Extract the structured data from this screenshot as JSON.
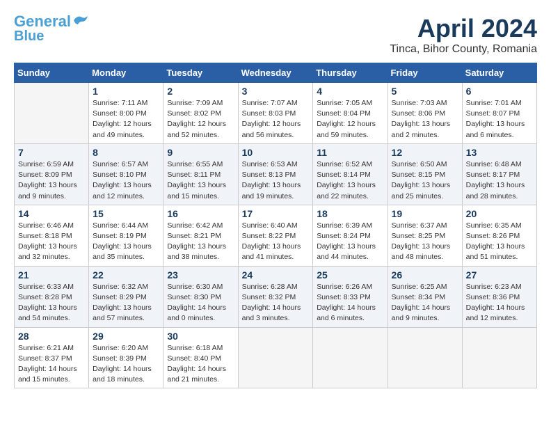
{
  "header": {
    "logo_line1": "General",
    "logo_line2": "Blue",
    "month_year": "April 2024",
    "location": "Tinca, Bihor County, Romania"
  },
  "weekdays": [
    "Sunday",
    "Monday",
    "Tuesday",
    "Wednesday",
    "Thursday",
    "Friday",
    "Saturday"
  ],
  "weeks": [
    [
      {
        "day": "",
        "info": ""
      },
      {
        "day": "1",
        "info": "Sunrise: 7:11 AM\nSunset: 8:00 PM\nDaylight: 12 hours\nand 49 minutes."
      },
      {
        "day": "2",
        "info": "Sunrise: 7:09 AM\nSunset: 8:02 PM\nDaylight: 12 hours\nand 52 minutes."
      },
      {
        "day": "3",
        "info": "Sunrise: 7:07 AM\nSunset: 8:03 PM\nDaylight: 12 hours\nand 56 minutes."
      },
      {
        "day": "4",
        "info": "Sunrise: 7:05 AM\nSunset: 8:04 PM\nDaylight: 12 hours\nand 59 minutes."
      },
      {
        "day": "5",
        "info": "Sunrise: 7:03 AM\nSunset: 8:06 PM\nDaylight: 13 hours\nand 2 minutes."
      },
      {
        "day": "6",
        "info": "Sunrise: 7:01 AM\nSunset: 8:07 PM\nDaylight: 13 hours\nand 6 minutes."
      }
    ],
    [
      {
        "day": "7",
        "info": "Sunrise: 6:59 AM\nSunset: 8:09 PM\nDaylight: 13 hours\nand 9 minutes."
      },
      {
        "day": "8",
        "info": "Sunrise: 6:57 AM\nSunset: 8:10 PM\nDaylight: 13 hours\nand 12 minutes."
      },
      {
        "day": "9",
        "info": "Sunrise: 6:55 AM\nSunset: 8:11 PM\nDaylight: 13 hours\nand 15 minutes."
      },
      {
        "day": "10",
        "info": "Sunrise: 6:53 AM\nSunset: 8:13 PM\nDaylight: 13 hours\nand 19 minutes."
      },
      {
        "day": "11",
        "info": "Sunrise: 6:52 AM\nSunset: 8:14 PM\nDaylight: 13 hours\nand 22 minutes."
      },
      {
        "day": "12",
        "info": "Sunrise: 6:50 AM\nSunset: 8:15 PM\nDaylight: 13 hours\nand 25 minutes."
      },
      {
        "day": "13",
        "info": "Sunrise: 6:48 AM\nSunset: 8:17 PM\nDaylight: 13 hours\nand 28 minutes."
      }
    ],
    [
      {
        "day": "14",
        "info": "Sunrise: 6:46 AM\nSunset: 8:18 PM\nDaylight: 13 hours\nand 32 minutes."
      },
      {
        "day": "15",
        "info": "Sunrise: 6:44 AM\nSunset: 8:19 PM\nDaylight: 13 hours\nand 35 minutes."
      },
      {
        "day": "16",
        "info": "Sunrise: 6:42 AM\nSunset: 8:21 PM\nDaylight: 13 hours\nand 38 minutes."
      },
      {
        "day": "17",
        "info": "Sunrise: 6:40 AM\nSunset: 8:22 PM\nDaylight: 13 hours\nand 41 minutes."
      },
      {
        "day": "18",
        "info": "Sunrise: 6:39 AM\nSunset: 8:24 PM\nDaylight: 13 hours\nand 44 minutes."
      },
      {
        "day": "19",
        "info": "Sunrise: 6:37 AM\nSunset: 8:25 PM\nDaylight: 13 hours\nand 48 minutes."
      },
      {
        "day": "20",
        "info": "Sunrise: 6:35 AM\nSunset: 8:26 PM\nDaylight: 13 hours\nand 51 minutes."
      }
    ],
    [
      {
        "day": "21",
        "info": "Sunrise: 6:33 AM\nSunset: 8:28 PM\nDaylight: 13 hours\nand 54 minutes."
      },
      {
        "day": "22",
        "info": "Sunrise: 6:32 AM\nSunset: 8:29 PM\nDaylight: 13 hours\nand 57 minutes."
      },
      {
        "day": "23",
        "info": "Sunrise: 6:30 AM\nSunset: 8:30 PM\nDaylight: 14 hours\nand 0 minutes."
      },
      {
        "day": "24",
        "info": "Sunrise: 6:28 AM\nSunset: 8:32 PM\nDaylight: 14 hours\nand 3 minutes."
      },
      {
        "day": "25",
        "info": "Sunrise: 6:26 AM\nSunset: 8:33 PM\nDaylight: 14 hours\nand 6 minutes."
      },
      {
        "day": "26",
        "info": "Sunrise: 6:25 AM\nSunset: 8:34 PM\nDaylight: 14 hours\nand 9 minutes."
      },
      {
        "day": "27",
        "info": "Sunrise: 6:23 AM\nSunset: 8:36 PM\nDaylight: 14 hours\nand 12 minutes."
      }
    ],
    [
      {
        "day": "28",
        "info": "Sunrise: 6:21 AM\nSunset: 8:37 PM\nDaylight: 14 hours\nand 15 minutes."
      },
      {
        "day": "29",
        "info": "Sunrise: 6:20 AM\nSunset: 8:39 PM\nDaylight: 14 hours\nand 18 minutes."
      },
      {
        "day": "30",
        "info": "Sunrise: 6:18 AM\nSunset: 8:40 PM\nDaylight: 14 hours\nand 21 minutes."
      },
      {
        "day": "",
        "info": ""
      },
      {
        "day": "",
        "info": ""
      },
      {
        "day": "",
        "info": ""
      },
      {
        "day": "",
        "info": ""
      }
    ]
  ]
}
